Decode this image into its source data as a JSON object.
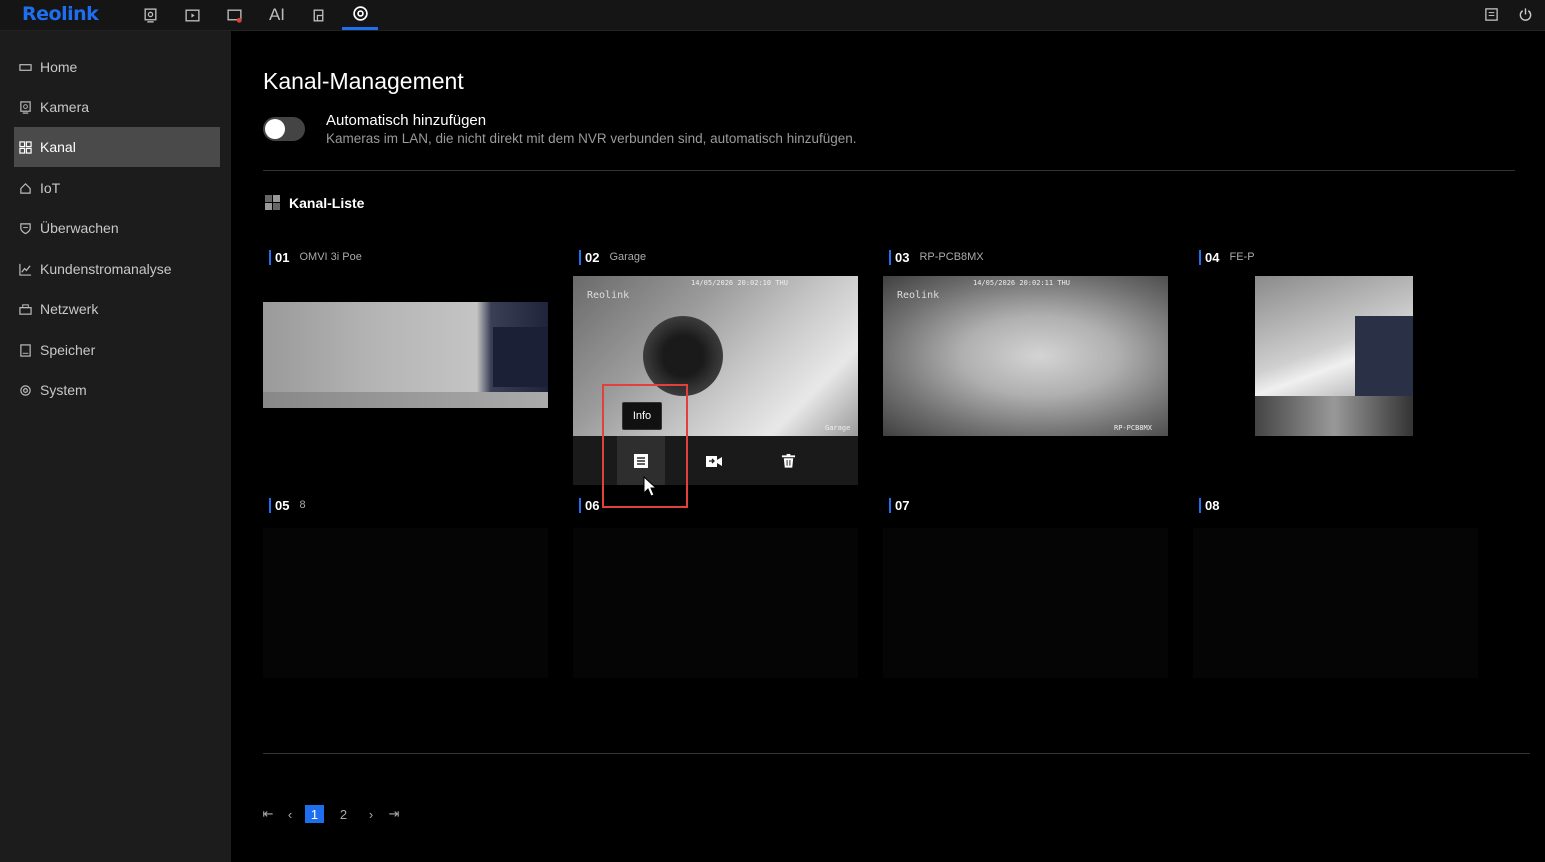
{
  "app": {
    "logo": "Reolink"
  },
  "topnav": {
    "items": [
      {
        "icon": "camera-preview-icon"
      },
      {
        "icon": "playback-icon"
      },
      {
        "icon": "alarm-icon"
      },
      {
        "icon": "ai-icon",
        "label": "AI"
      },
      {
        "icon": "files-icon"
      },
      {
        "icon": "settings-icon",
        "active": true
      }
    ],
    "right": [
      {
        "icon": "notes-icon"
      },
      {
        "icon": "power-icon"
      }
    ]
  },
  "sidebar": {
    "items": [
      {
        "label": "Home",
        "icon": "home-display-icon"
      },
      {
        "label": "Kamera",
        "icon": "camera-icon"
      },
      {
        "label": "Kanal",
        "icon": "channel-grid-icon",
        "active": true
      },
      {
        "label": "IoT",
        "icon": "house-icon"
      },
      {
        "label": "Überwachen",
        "icon": "shield-icon"
      },
      {
        "label": "Kundenstromanalyse",
        "icon": "chart-icon"
      },
      {
        "label": "Netzwerk",
        "icon": "network-icon"
      },
      {
        "label": "Speicher",
        "icon": "storage-icon"
      },
      {
        "label": "System",
        "icon": "gear-icon"
      }
    ]
  },
  "main": {
    "title": "Kanal-Management",
    "auto_add": {
      "title": "Automatisch hinzufügen",
      "description": "Kameras im LAN, die nicht direkt mit dem NVR verbunden sind, automatisch hinzufügen.",
      "enabled": false
    },
    "list_title": "Kanal-Liste",
    "channels": [
      {
        "num": "01",
        "name": "OMVI 3i Poe"
      },
      {
        "num": "02",
        "name": "Garage",
        "osd_time": "14/05/2026 20:02:10 THU",
        "osd_name": "Garage",
        "osd_logo": "Reolink"
      },
      {
        "num": "03",
        "name": "RP-PCB8MX",
        "osd_time": "14/05/2026 20:02:11 THU",
        "osd_name": "RP-PCB8MX",
        "osd_logo": "Reolink"
      },
      {
        "num": "04",
        "name": "FE-P"
      },
      {
        "num": "05",
        "name": "8"
      },
      {
        "num": "06",
        "name": ""
      },
      {
        "num": "07",
        "name": ""
      },
      {
        "num": "08",
        "name": ""
      }
    ],
    "actions": {
      "tooltip": "Info",
      "buttons": [
        {
          "icon": "info-list-icon"
        },
        {
          "icon": "camera-replace-icon"
        },
        {
          "icon": "trash-icon"
        }
      ]
    },
    "pagination": {
      "pages": [
        "1",
        "2"
      ],
      "current": "1"
    }
  }
}
